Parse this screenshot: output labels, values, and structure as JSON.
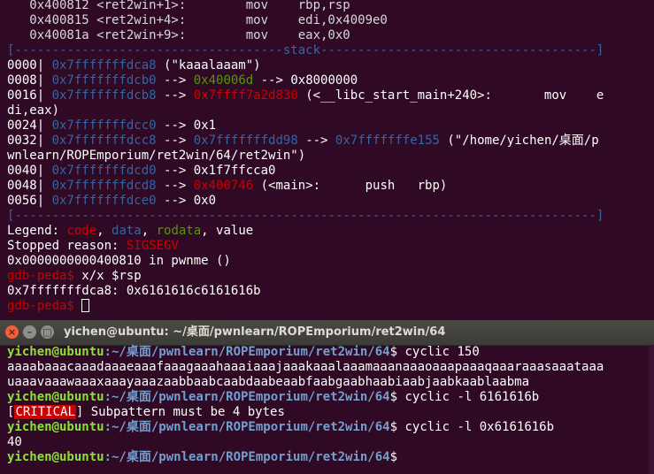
{
  "top_terminal": {
    "lines": [
      {
        "segments": [
          {
            "t": "   0x400812 <ret2win+1>:        mov    rbp,rsp",
            "c": "t-dim"
          }
        ]
      },
      {
        "segments": [
          {
            "t": "   0x400815 <ret2win+4>:        mov    edi,0x4009e0",
            "c": "t-dim"
          }
        ]
      },
      {
        "segments": [
          {
            "t": "   0x40081a <ret2win+9>:        mov    eax,0x0",
            "c": "t-dim"
          }
        ]
      },
      {
        "segments": [
          {
            "t": "[------------------------------------stack-------------------------------------]",
            "c": "c-blue"
          }
        ]
      },
      {
        "segments": [
          {
            "t": "0000| ",
            "c": ""
          },
          {
            "t": "0x7fffffffdca8",
            "c": "c-blue"
          },
          {
            "t": " (\"kaaalaaam\")",
            "c": ""
          }
        ]
      },
      {
        "segments": [
          {
            "t": "0008| ",
            "c": ""
          },
          {
            "t": "0x7fffffffdcb0",
            "c": "c-blue"
          },
          {
            "t": " --> ",
            "c": ""
          },
          {
            "t": "0x40006d",
            "c": "c-green"
          },
          {
            "t": " --> 0x8000000",
            "c": ""
          }
        ]
      },
      {
        "segments": [
          {
            "t": "0016| ",
            "c": ""
          },
          {
            "t": "0x7fffffffdcb8",
            "c": "c-blue"
          },
          {
            "t": " --> ",
            "c": ""
          },
          {
            "t": "0x7ffff7a2d830",
            "c": "c-red"
          },
          {
            "t": " (<__libc_start_main+240>:       mov    e",
            "c": ""
          }
        ]
      },
      {
        "segments": [
          {
            "t": "di,eax)",
            "c": ""
          }
        ]
      },
      {
        "segments": [
          {
            "t": "0024| ",
            "c": ""
          },
          {
            "t": "0x7fffffffdcc0",
            "c": "c-blue"
          },
          {
            "t": " --> 0x1",
            "c": ""
          }
        ]
      },
      {
        "segments": [
          {
            "t": "0032| ",
            "c": ""
          },
          {
            "t": "0x7fffffffdcc8",
            "c": "c-blue"
          },
          {
            "t": " --> ",
            "c": ""
          },
          {
            "t": "0x7fffffffdd98",
            "c": "c-blue"
          },
          {
            "t": " --> ",
            "c": ""
          },
          {
            "t": "0x7fffffffe155",
            "c": "c-blue"
          },
          {
            "t": " (\"/home/yichen/桌面/p",
            "c": ""
          }
        ]
      },
      {
        "segments": [
          {
            "t": "wnlearn/ROPEmporium/ret2win/64/ret2win\")",
            "c": ""
          }
        ]
      },
      {
        "segments": [
          {
            "t": "0040| ",
            "c": ""
          },
          {
            "t": "0x7fffffffdcd0",
            "c": "c-blue"
          },
          {
            "t": " --> 0x1f7ffcca0",
            "c": ""
          }
        ]
      },
      {
        "segments": [
          {
            "t": "0048| ",
            "c": ""
          },
          {
            "t": "0x7fffffffdcd8",
            "c": "c-blue"
          },
          {
            "t": " --> ",
            "c": ""
          },
          {
            "t": "0x400746",
            "c": "c-red"
          },
          {
            "t": " (<main>:      push   rbp)",
            "c": ""
          }
        ]
      },
      {
        "segments": [
          {
            "t": "0056| ",
            "c": ""
          },
          {
            "t": "0x7fffffffdce0",
            "c": "c-blue"
          },
          {
            "t": " --> 0x0",
            "c": ""
          }
        ]
      },
      {
        "segments": [
          {
            "t": "[------------------------------------------------------------------------------]",
            "c": "c-blue"
          }
        ]
      },
      {
        "segments": [
          {
            "t": "Legend: ",
            "c": ""
          },
          {
            "t": "code",
            "c": "c-red"
          },
          {
            "t": ", ",
            "c": ""
          },
          {
            "t": "data",
            "c": "c-blue"
          },
          {
            "t": ", ",
            "c": ""
          },
          {
            "t": "rodata",
            "c": "c-green"
          },
          {
            "t": ", value",
            "c": ""
          }
        ]
      },
      {
        "segments": [
          {
            "t": "Stopped reason: ",
            "c": ""
          },
          {
            "t": "SIGSEGV",
            "c": "c-red"
          }
        ]
      },
      {
        "segments": [
          {
            "t": "0x0000000000400810 in pwnme ()",
            "c": ""
          }
        ]
      },
      {
        "segments": [
          {
            "t": "gdb-peda$",
            "c": "c-red"
          },
          {
            "t": " x/x $rsp",
            "c": ""
          }
        ]
      },
      {
        "segments": [
          {
            "t": "0x7fffffffdca8: 0x6161616c6161616b",
            "c": ""
          }
        ]
      },
      {
        "segments": [
          {
            "t": "gdb-peda$",
            "c": "c-red"
          },
          {
            "t": " ",
            "c": ""
          }
        ]
      }
    ]
  },
  "bottom_terminal": {
    "title": "yichen@ubuntu: ~/桌面/pwnlearn/ROPEmporium/ret2win/64",
    "close_glyph": "×",
    "min_glyph": "–",
    "max_glyph": "□",
    "prompt_user": "yichen@ubuntu",
    "prompt_path": ":~/桌面/pwnlearn/ROPEmporium/ret2win/64",
    "prompt_sign": "$",
    "cmd1": " cyclic 150",
    "out1a": "aaaabaaacaaadaaaeaaafaaagaaahaaaiaaajaaakaaalaaamaaanaaaoaaapaaaqaaaraaasaaataaa",
    "out1b": "uaaavaaawaaaxaaayaaazaabbaabcaabdaabeaabfaabgaabhaabiaabjaabkaablaabma",
    "cmd2": " cyclic -l 6161616b",
    "critical_label": "CRITICAL",
    "critical_pre": "[",
    "critical_post": "] Subpattern must be 4 bytes",
    "cmd3": " cyclic -l 0x6161616b",
    "out3": "40",
    "cmd4": ""
  }
}
